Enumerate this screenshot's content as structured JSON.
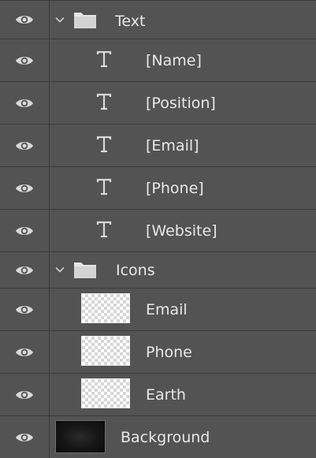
{
  "layers_panel": {
    "layers": [
      {
        "kind": "group",
        "label": "Text",
        "expanded": true,
        "visible": true,
        "icon": "folder-icon"
      },
      {
        "kind": "type",
        "label": "[Name]",
        "visible": true,
        "icon": "type-layer-icon"
      },
      {
        "kind": "type",
        "label": "[Position]",
        "visible": true,
        "icon": "type-layer-icon"
      },
      {
        "kind": "type",
        "label": "[Email]",
        "visible": true,
        "icon": "type-layer-icon"
      },
      {
        "kind": "type",
        "label": "[Phone]",
        "visible": true,
        "icon": "type-layer-icon"
      },
      {
        "kind": "type",
        "label": "[Website]",
        "visible": true,
        "icon": "type-layer-icon"
      },
      {
        "kind": "group",
        "label": "Icons",
        "expanded": true,
        "visible": true,
        "icon": "folder-icon"
      },
      {
        "kind": "pixel",
        "label": "Email",
        "visible": true,
        "thumbnail": "transparent"
      },
      {
        "kind": "pixel",
        "label": "Phone",
        "visible": true,
        "thumbnail": "transparent"
      },
      {
        "kind": "pixel",
        "label": "Earth",
        "visible": true,
        "thumbnail": "transparent"
      },
      {
        "kind": "pixel",
        "label": "Background",
        "visible": true,
        "thumbnail": "dark"
      }
    ]
  },
  "colors": {
    "panel_bg": "#535353",
    "divider": "#3b3b3b",
    "text": "#e8e8e8",
    "icon": "#d9d9d9"
  }
}
